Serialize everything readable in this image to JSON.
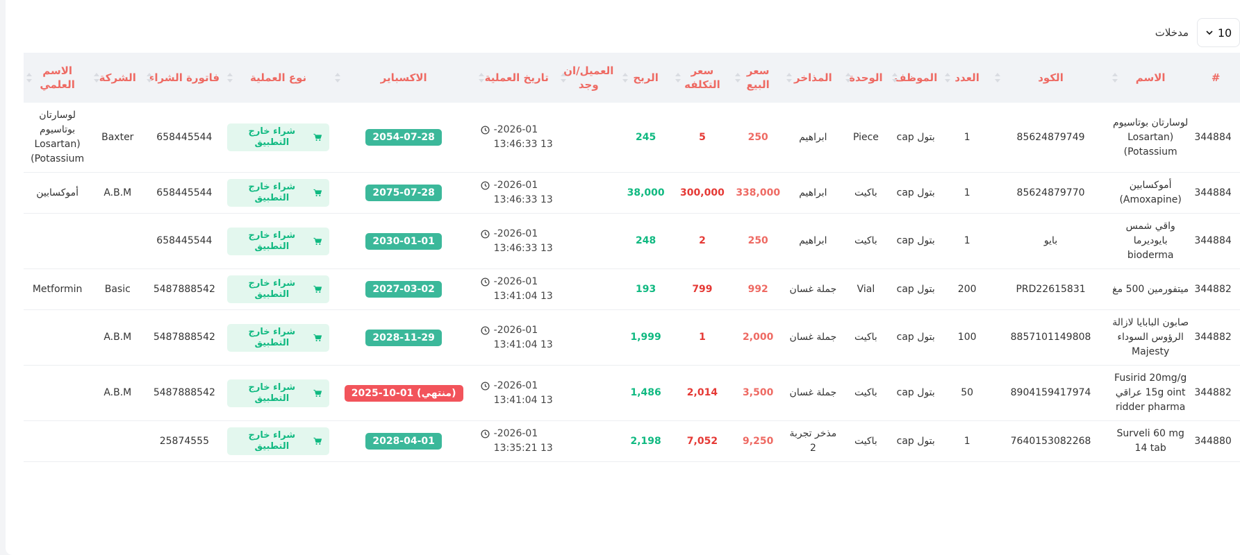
{
  "controls": {
    "page_size": "10",
    "entries_label": "مدخلات"
  },
  "columns": [
    "#",
    "الاسم",
    "الكود",
    "العدد",
    "الموظف",
    "الوحدة",
    "المذاخر",
    "سعر البيع",
    "سعر التكلفه",
    "الربح",
    "العميل/ان وجد",
    "تاريخ العملية",
    "الاكسباير",
    "نوع العملية",
    "فاتورة الشراء",
    "الشركة",
    "الاسم العلمي"
  ],
  "operation_label": "شراء خارج التطبيق",
  "rows": [
    {
      "id": "344884",
      "name": "لوسارتان بوتاسيوم Losartan) (Potassium",
      "code": "85624879749",
      "qty": "1",
      "employee": "بتول cap",
      "unit": "Piece",
      "store": "ابراهيم",
      "sell": "250",
      "cost": "5",
      "profit": "245",
      "client": "",
      "date": "2026-01-",
      "time": "13 13:46:33",
      "expiry": "2054-07-28",
      "expired": false,
      "invoice": "658445544",
      "company": "Baxter",
      "scientific": "لوسارتان بوتاسيوم Losartan) (Potassium"
    },
    {
      "id": "344884",
      "name": "أموكسابين (Amoxapine)",
      "code": "85624879770",
      "qty": "1",
      "employee": "بتول cap",
      "unit": "باكيت",
      "store": "ابراهيم",
      "sell": "338,000",
      "cost": "300,000",
      "profit": "38,000",
      "client": "",
      "date": "2026-01-",
      "time": "13 13:46:33",
      "expiry": "2075-07-28",
      "expired": false,
      "invoice": "658445544",
      "company": "A.B.M",
      "scientific": "أموكسابين"
    },
    {
      "id": "344884",
      "name": "واقي شمس بايوديرما bioderma",
      "code": "بايو",
      "qty": "1",
      "employee": "بتول cap",
      "unit": "باكيت",
      "store": "ابراهيم",
      "sell": "250",
      "cost": "2",
      "profit": "248",
      "client": "",
      "date": "2026-01-",
      "time": "13 13:46:33",
      "expiry": "2030-01-01",
      "expired": false,
      "invoice": "658445544",
      "company": "",
      "scientific": ""
    },
    {
      "id": "344882",
      "name": "ميتفورمين 500 مغ",
      "code": "PRD22615831",
      "qty": "200",
      "employee": "بتول cap",
      "unit": "Vial",
      "store": "جملة غسان",
      "sell": "992",
      "cost": "799",
      "profit": "193",
      "client": "",
      "date": "2026-01-",
      "time": "13 13:41:04",
      "expiry": "2027-03-02",
      "expired": false,
      "invoice": "5487888542",
      "company": "Basic",
      "scientific": "Metformin"
    },
    {
      "id": "344882",
      "name": "صابون البابايا لازالة الرؤوس السوداء Majesty",
      "code": "8857101149808",
      "qty": "100",
      "employee": "بتول cap",
      "unit": "باكيت",
      "store": "جملة غسان",
      "sell": "2,000",
      "cost": "1",
      "profit": "1,999",
      "client": "",
      "date": "2026-01-",
      "time": "13 13:41:04",
      "expiry": "2028-11-29",
      "expired": false,
      "invoice": "5487888542",
      "company": "A.B.M",
      "scientific": ""
    },
    {
      "id": "344882",
      "name": "Fusirid 20mg/g 15g oint عراقي ridder pharma",
      "code": "8904159417974",
      "qty": "50",
      "employee": "بتول cap",
      "unit": "باكيت",
      "store": "جملة غسان",
      "sell": "3,500",
      "cost": "2,014",
      "profit": "1,486",
      "client": "",
      "date": "2026-01-",
      "time": "13 13:41:04",
      "expiry": "2025-10-01 (منتهي)",
      "expired": true,
      "invoice": "5487888542",
      "company": "A.B.M",
      "scientific": ""
    },
    {
      "id": "344880",
      "name": "Surveli 60 mg 14 tab",
      "code": "7640153082268",
      "qty": "1",
      "employee": "بتول cap",
      "unit": "باكيت",
      "store": "مذخر تجربة 2",
      "sell": "9,250",
      "cost": "7,052",
      "profit": "2,198",
      "client": "",
      "date": "2026-01-",
      "time": "13 13:35:21",
      "expiry": "2028-04-01",
      "expired": false,
      "invoice": "25874555",
      "company": "",
      "scientific": ""
    }
  ],
  "colors": {
    "accent": "#ee6a63",
    "green": "#10b981",
    "expiry": "#3bb89a",
    "expired": "#f2545b"
  }
}
